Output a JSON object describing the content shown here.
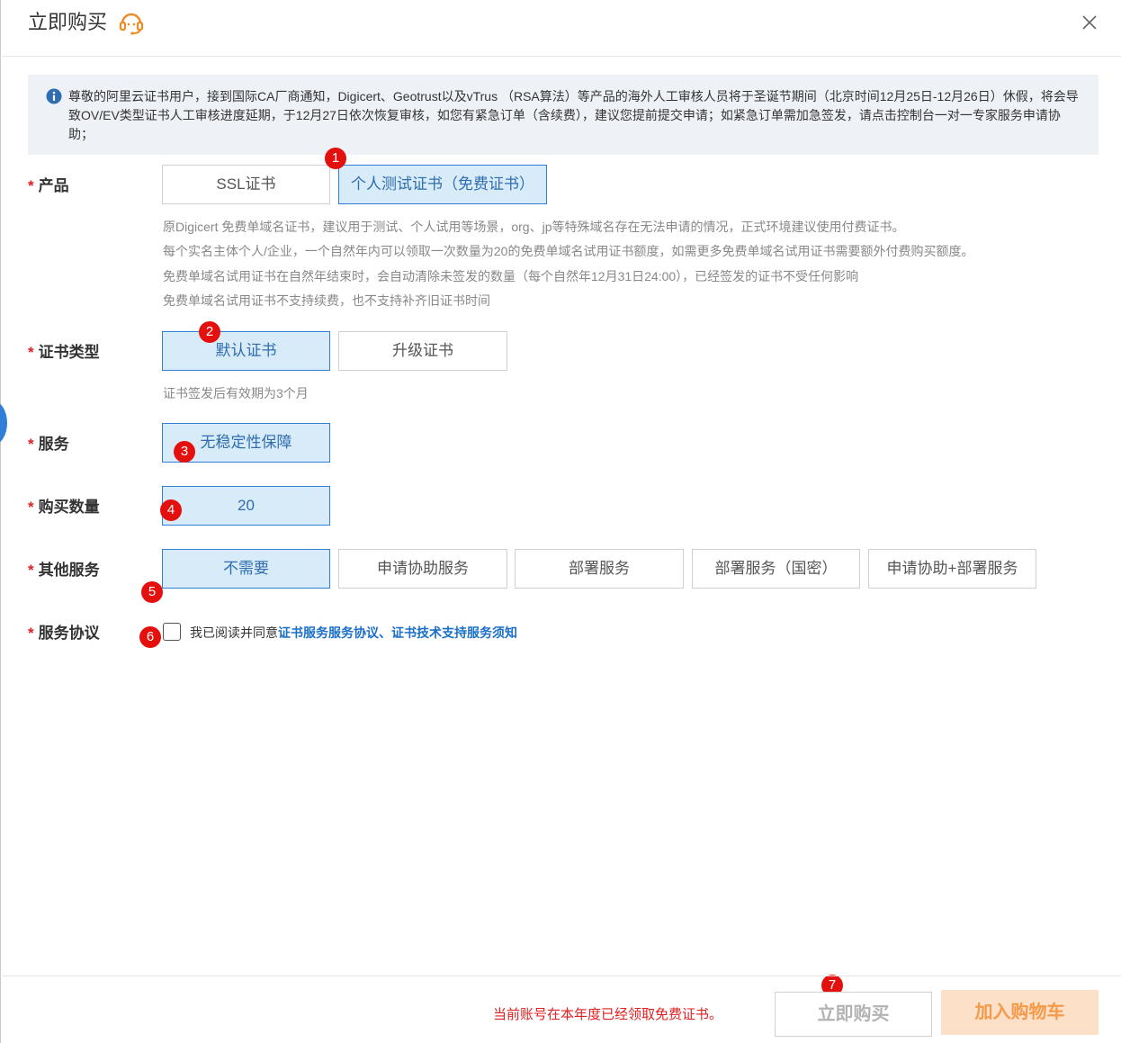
{
  "header": {
    "title": "立即购买",
    "support_icon": "headset-icon",
    "close_icon": "close-icon"
  },
  "notice": {
    "icon": "info-icon",
    "text": "尊敬的阿里云证书用户，接到国际CA厂商通知，Digicert、Geotrust以及vTrus （RSA算法）等产品的海外人工审核人员将于圣诞节期间（北京时间12月25日-12月26日）休假，将会导致OV/EV类型证书人工审核进度延期，于12月27日依次恢复审核，如您有紧急订单（含续费），建议您提前提交申请；如紧急订单需加急签发，请点击控制台一对一专家服务申请协助；"
  },
  "form": {
    "product": {
      "label": "产品",
      "options": [
        "SSL证书",
        "个人测试证书（免费证书）"
      ],
      "selected": "个人测试证书（免费证书）",
      "hints": [
        "原Digicert 免费单域名证书，建议用于测试、个人试用等场景，org、jp等特殊域名存在无法申请的情况，正式环境建议使用付费证书。",
        "每个实名主体个人/企业，一个自然年内可以领取一次数量为20的免费单域名试用证书额度，如需更多免费单域名试用证书需要额外付费购买额度。",
        "免费单域名试用证书在自然年结束时，会自动清除未签发的数量（每个自然年12月31日24:00），已经签发的证书不受任何影响",
        "免费单域名试用证书不支持续费，也不支持补齐旧证书时间"
      ]
    },
    "cert_type": {
      "label": "证书类型",
      "options": [
        "默认证书",
        "升级证书"
      ],
      "selected": "默认证书",
      "hint": "证书签发后有效期为3个月"
    },
    "service": {
      "label": "服务",
      "options": [
        "无稳定性保障"
      ],
      "selected": "无稳定性保障"
    },
    "quantity": {
      "label": "购买数量",
      "value": "20"
    },
    "other_service": {
      "label": "其他服务",
      "options": [
        "不需要",
        "申请协助服务",
        "部署服务",
        "部署服务（国密）",
        "申请协助+部署服务"
      ],
      "selected": "不需要"
    },
    "agreement": {
      "label": "服务协议",
      "prefix": "我已阅读并同意",
      "link1": "证书服务服务协议",
      "separator": "、",
      "link2": "证书技术支持服务须知",
      "checked": false
    }
  },
  "badges": [
    "1",
    "2",
    "3",
    "4",
    "5",
    "6",
    "7"
  ],
  "footer": {
    "note": "当前账号在本年度已经领取免费证书。",
    "buy_label": "立即购买",
    "cart_label": "加入购物车"
  },
  "colors": {
    "accent": "#2f7fd8",
    "selected_bg": "#d8ebf8",
    "badge": "#e3100d",
    "warning_text": "#e02020",
    "cart_bg": "#fde0c8",
    "cart_text": "#f49a4a",
    "support_icon": "#f08a24"
  }
}
